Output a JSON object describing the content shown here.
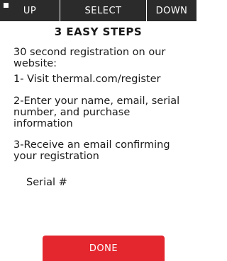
{
  "toolbar": {
    "up_label": "UP",
    "select_label": "SELECT",
    "down_label": "DOWN"
  },
  "content": {
    "title": "3 EASY STEPS",
    "intro": "30 second registration on our website:",
    "step1": "1- Visit thermal.com/register",
    "step2": "2-Enter your name, email, serial number, and purchase information",
    "step3": "3-Receive an email confirming your registration",
    "serial_label": "Serial #"
  },
  "actions": {
    "done_label": "DONE"
  },
  "colors": {
    "topbar": "#2b2b2b",
    "accent": "#e4262e"
  }
}
